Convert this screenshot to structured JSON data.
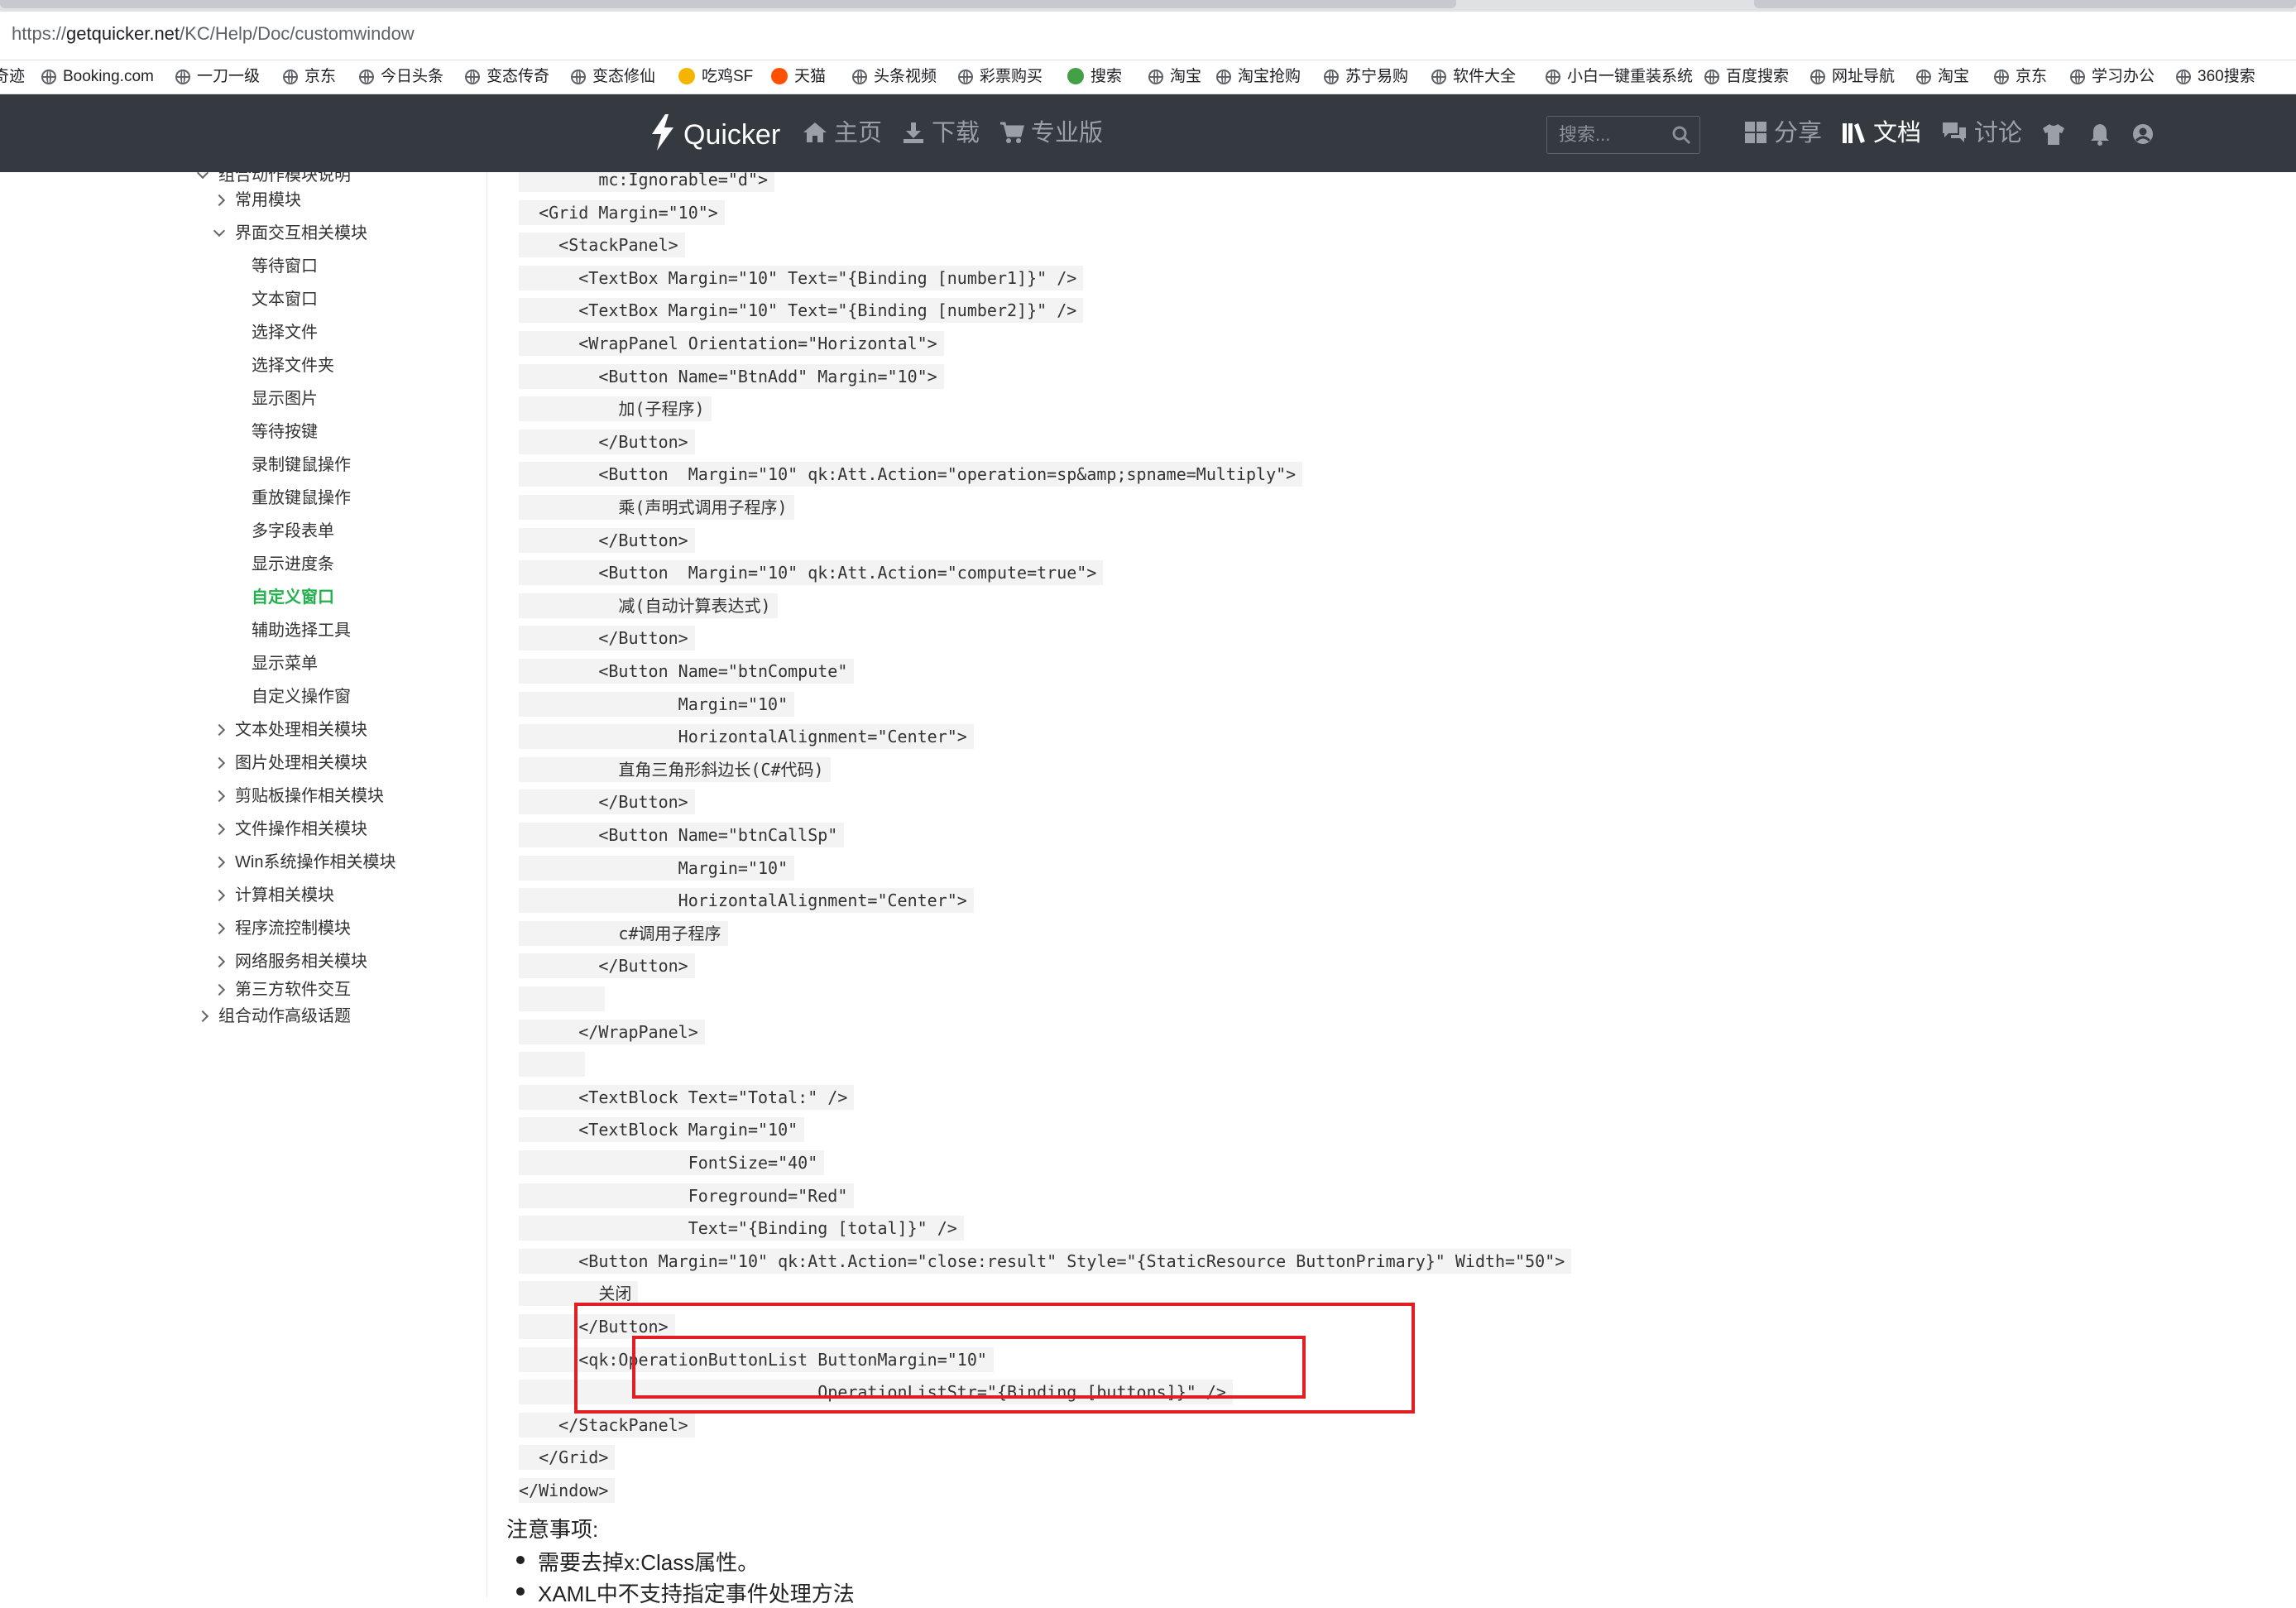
{
  "browser": {
    "url_prefix": "https://",
    "url_host": "getquicker.net",
    "url_path": "/KC/Help/Doc/customwindow",
    "bookmarks": [
      {
        "label": "奇迹",
        "icon": "none"
      },
      {
        "label": "Booking.com",
        "icon": "globe-icon"
      },
      {
        "label": "一刀一级",
        "icon": "globe-icon"
      },
      {
        "label": "京东",
        "icon": "globe-icon"
      },
      {
        "label": "今日头条",
        "icon": "globe-icon"
      },
      {
        "label": "变态传奇",
        "icon": "globe-icon"
      },
      {
        "label": "变态修仙",
        "icon": "globe-icon"
      },
      {
        "label": "吃鸡SF",
        "icon": "yellow-icon"
      },
      {
        "label": "天猫",
        "icon": "tmall-icon"
      },
      {
        "label": "头条视频",
        "icon": "globe-icon"
      },
      {
        "label": "彩票购买",
        "icon": "globe-icon"
      },
      {
        "label": "搜索",
        "icon": "green-icon"
      },
      {
        "label": "淘宝",
        "icon": "globe-icon"
      },
      {
        "label": "淘宝抢购",
        "icon": "globe-icon"
      },
      {
        "label": "苏宁易购",
        "icon": "globe-icon"
      },
      {
        "label": "软件大全",
        "icon": "globe-icon"
      },
      {
        "label": "小白一键重装系统",
        "icon": "globe-icon"
      },
      {
        "label": "百度搜索",
        "icon": "globe-icon"
      },
      {
        "label": "网址导航",
        "icon": "globe-icon"
      },
      {
        "label": "淘宝",
        "icon": "globe-icon"
      },
      {
        "label": "京东",
        "icon": "globe-icon"
      },
      {
        "label": "学习办公",
        "icon": "globe-icon"
      },
      {
        "label": "360搜索",
        "icon": "globe-icon"
      }
    ]
  },
  "navbar": {
    "brand": "Quicker",
    "links": [
      "主页",
      "下载",
      "专业版"
    ],
    "search_placeholder": "搜索...",
    "right_links": [
      "分享",
      "文档",
      "讨论"
    ],
    "active_link": "文档"
  },
  "sidebar": {
    "items": [
      {
        "label": "组合动作模块说明",
        "level": 0,
        "chevron": "down"
      },
      {
        "label": "常用模块",
        "level": 1,
        "chevron": "right"
      },
      {
        "label": "界面交互相关模块",
        "level": 1,
        "chevron": "down"
      },
      {
        "label": "等待窗口",
        "level": 2,
        "chevron": "none"
      },
      {
        "label": "文本窗口",
        "level": 2,
        "chevron": "none"
      },
      {
        "label": "选择文件",
        "level": 2,
        "chevron": "none"
      },
      {
        "label": "选择文件夹",
        "level": 2,
        "chevron": "none"
      },
      {
        "label": "显示图片",
        "level": 2,
        "chevron": "none"
      },
      {
        "label": "等待按键",
        "level": 2,
        "chevron": "none"
      },
      {
        "label": "录制键鼠操作",
        "level": 2,
        "chevron": "none"
      },
      {
        "label": "重放键鼠操作",
        "level": 2,
        "chevron": "none"
      },
      {
        "label": "多字段表单",
        "level": 2,
        "chevron": "none"
      },
      {
        "label": "显示进度条",
        "level": 2,
        "chevron": "none"
      },
      {
        "label": "自定义窗口",
        "level": 2,
        "chevron": "none",
        "active": true
      },
      {
        "label": "辅助选择工具",
        "level": 2,
        "chevron": "none"
      },
      {
        "label": "显示菜单",
        "level": 2,
        "chevron": "none"
      },
      {
        "label": "自定义操作窗",
        "level": 2,
        "chevron": "none"
      },
      {
        "label": "文本处理相关模块",
        "level": 1,
        "chevron": "right"
      },
      {
        "label": "图片处理相关模块",
        "level": 1,
        "chevron": "right"
      },
      {
        "label": "剪贴板操作相关模块",
        "level": 1,
        "chevron": "right"
      },
      {
        "label": "文件操作相关模块",
        "level": 1,
        "chevron": "right"
      },
      {
        "label": "Win系统操作相关模块",
        "level": 1,
        "chevron": "right"
      },
      {
        "label": "计算相关模块",
        "level": 1,
        "chevron": "right"
      },
      {
        "label": "程序流控制模块",
        "level": 1,
        "chevron": "right"
      },
      {
        "label": "网络服务相关模块",
        "level": 1,
        "chevron": "right"
      },
      {
        "label": "第三方软件交互",
        "level": 1,
        "chevron": "right"
      },
      {
        "label": "组合动作高级话题",
        "level": 0,
        "chevron": "right"
      }
    ]
  },
  "code": {
    "lines": [
      "        mc:Ignorable=\"d\">",
      "  <Grid Margin=\"10\">",
      "    <StackPanel>",
      "      <TextBox Margin=\"10\" Text=\"{Binding [number1]}\" />",
      "      <TextBox Margin=\"10\" Text=\"{Binding [number2]}\" />",
      "      <WrapPanel Orientation=\"Horizontal\">",
      "        <Button Name=\"BtnAdd\" Margin=\"10\">",
      "          加(子程序)",
      "        </Button>",
      "        <Button  Margin=\"10\" qk:Att.Action=\"operation=sp&amp;spname=Multiply\">",
      "          乘(声明式调用子程序)",
      "        </Button>",
      "        <Button  Margin=\"10\" qk:Att.Action=\"compute=true\">",
      "          减(自动计算表达式)",
      "        </Button>",
      "        <Button Name=\"btnCompute\"",
      "                Margin=\"10\"",
      "                HorizontalAlignment=\"Center\">",
      "          直角三角形斜边长(C#代码)",
      "        </Button>",
      "        <Button Name=\"btnCallSp\"",
      "                Margin=\"10\"",
      "                HorizontalAlignment=\"Center\">",
      "          c#调用子程序",
      "        </Button>",
      "        ",
      "      </WrapPanel>",
      "      ",
      "      <TextBlock Text=\"Total:\" />",
      "      <TextBlock Margin=\"10\"",
      "                 FontSize=\"40\"",
      "                 Foreground=\"Red\"",
      "                 Text=\"{Binding [total]}\" />",
      "      <Button Margin=\"10\" qk:Att.Action=\"close:result\" Style=\"{StaticResource ButtonPrimary}\" Width=\"50\">",
      "        关闭",
      "      </Button>",
      "      <qk:OperationButtonList ButtonMargin=\"10\"",
      "                              OperationListStr=\"{Binding [buttons]}\" />",
      "    </StackPanel>",
      "  </Grid>",
      "</Window>"
    ]
  },
  "notes": {
    "title": "注意事项:",
    "items": [
      "需要去掉x:Class属性。",
      "XAML中不支持指定事件处理方法"
    ]
  },
  "colors": {
    "navbar_bg": "#343a40",
    "active_sidebar": "#22b14c",
    "highlight_box": "#e01e24",
    "code_bg": "#f3f3f3"
  }
}
